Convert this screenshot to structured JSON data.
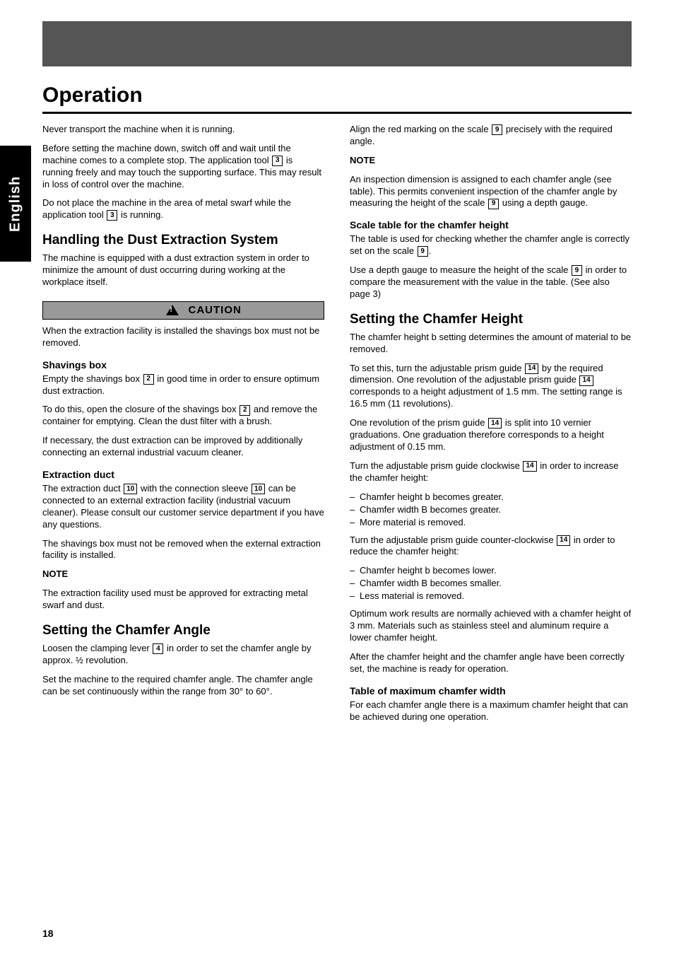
{
  "language_tab": "English",
  "section_title": "Operation",
  "page_number": "18",
  "caution_label": "CAUTION",
  "left": {
    "para1": "Never transport the machine when it is running.",
    "para2a": "Before setting the machine down, switch off and wait until the machine comes to a complete stop. The application tool",
    "para2b": "is running freely and may touch the supporting surface. This may result in loss of control over the machine.",
    "para2c": "Do not place the machine in the area of metal swarf while the application tool",
    "para2d": "is running.",
    "handling_head": "Handling the Dust Extraction System",
    "handling_p": "The machine is equipped with a dust extraction system in order to minimize the amount of dust occurring during working at the workplace itself.",
    "caution_p": "When the extraction facility is installed the shavings box must not be removed.",
    "box_head": "Shavings box",
    "box_p1a": "Empty the shavings box",
    "box_p1b": "in good time in order to ensure optimum dust extraction.",
    "box_p2a": "To do this, open the closure of the shavings box",
    "box_p2b": "and remove the container for emptying. Clean the dust filter with a brush.",
    "box_p3": "If necessary, the dust extraction can be improved by additionally connecting an external industrial vacuum cleaner.",
    "duct_head": "Extraction duct",
    "duct_p1a": "The extraction duct",
    "duct_p1b": "with the connection sleeve",
    "duct_p1c": "can be connected to an external extraction facility (industrial vacuum cleaner). Please consult our customer service department if you have any questions.",
    "duct_p2": "The shavings box must not be removed when the external extraction facility is installed.",
    "note_label": "NOTE",
    "note_text": "The extraction facility used must be approved for extracting metal swarf and dust.",
    "chamfer_head": "Setting the Chamfer Angle",
    "chamfer_p1a": "Loosen the clamping lever",
    "chamfer_p1b": "in order to set the chamfer angle by approx. ½ revolution.",
    "chamfer_p2": "Set the machine to the required chamfer angle. The chamfer angle can be set continuously within the range from 30° to 60°."
  },
  "right": {
    "para1a": "Align the red marking on the scale",
    "para1b": "precisely with the required angle.",
    "note1_label": "NOTE",
    "note1_text": "An inspection dimension is assigned to each chamfer angle (see table). This permits convenient inspection of the chamfer angle by measuring the height of the scale",
    "note1_text2": "using a depth gauge.",
    "table_head": "Scale table for the chamfer height",
    "table_p1a": "The table is used for checking whether the chamfer angle is correctly set on the scale",
    "table_p1b": ".",
    "table_p2a": "Use a depth gauge to measure the height of the scale",
    "table_p2b": "in order to compare the measurement with the value in the table. (See also page 3)",
    "height_head": "Setting the Chamfer Height",
    "height_p1": "The chamfer height b setting determines the amount of material to be removed.",
    "height_p2a": "To set this, turn the adjustable prism guide",
    "height_p2b": "by the required dimension. One revolution of the adjustable prism guide",
    "height_p2c": "corresponds to a height adjustment of 1.5 mm. The setting range is 16.5 mm (11 revolutions).",
    "height_p3a": "One revolution of the prism guide",
    "height_p3b": "is split into 10 vernier graduations. One graduation therefore corresponds to a height adjustment of 0.15 mm.",
    "height_p4a": "Turn the adjustable prism guide clockwise",
    "height_p4b": "in order to increase the chamfer height:",
    "height_list": [
      "Chamfer height b becomes greater.",
      "Chamfer width B becomes greater.",
      "More material is removed."
    ],
    "height_p5a": "Turn the adjustable prism guide counter-clockwise",
    "height_p5b": "in order to reduce the chamfer height:",
    "height_list2": [
      "Chamfer height b becomes lower.",
      "Chamfer width B becomes smaller.",
      "Less material is removed."
    ],
    "height_note": "Optimum work results are normally achieved with a chamfer height of 3 mm. Materials such as stainless steel and aluminum require a lower chamfer height.",
    "height_p6": "After the chamfer height and the chamfer angle have been correctly set, the machine is ready for operation.",
    "calc_head": "Table of maximum chamfer width",
    "calc_p": "For each chamfer angle there is a maximum chamfer height that can be achieved during one operation."
  },
  "refs": {
    "r2": "2",
    "r3": "3",
    "r4": "4",
    "r9": "9",
    "r10": "10",
    "r14": "14"
  }
}
